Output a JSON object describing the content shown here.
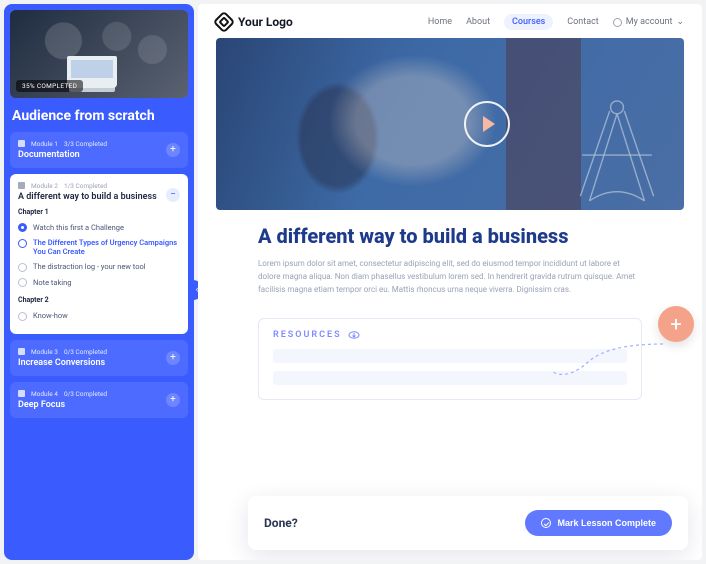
{
  "sidebar": {
    "progress_label": "35% COMPLETED",
    "course_title": "Audience from scratch",
    "modules": [
      {
        "index_label": "Module 1",
        "completed_label": "3/3 Completed",
        "name": "Documentation"
      },
      {
        "index_label": "Module 2",
        "completed_label": "1/3 Completed",
        "name": "A different way to build a business",
        "chapters": [
          {
            "label": "Chapter 1",
            "lessons": [
              {
                "status": "done",
                "title": "Watch this first a Challenge"
              },
              {
                "status": "active",
                "title": "The Different Types of Urgency Campaigns You Can Create"
              },
              {
                "status": "todo",
                "title": "The distraction log - your new tool"
              },
              {
                "status": "todo",
                "title": "Note taking"
              }
            ]
          },
          {
            "label": "Chapter 2",
            "lessons": [
              {
                "status": "todo",
                "title": "Know-how"
              }
            ]
          }
        ]
      },
      {
        "index_label": "Module 3",
        "completed_label": "0/3 Completed",
        "name": "Increase Conversions"
      },
      {
        "index_label": "Module 4",
        "completed_label": "0/3 Completed",
        "name": "Deep Focus"
      }
    ]
  },
  "header": {
    "logo_text": "Your Logo",
    "nav": {
      "home": "Home",
      "about": "About",
      "courses": "Courses",
      "contact": "Contact",
      "account": "My account"
    }
  },
  "lesson": {
    "title": "A different way to build a business",
    "body": "Lorem ipsum dolor sit amet, consectetur adipiscing elit, sed do eiusmod tempor incididunt ut labore et dolore magna aliqua. Non diam phasellus vestibulum lorem sed. In hendrerit gravida rutrum quisque. Amet facilisis magna etiam tempor orci eu. Mattis rhoncus urna neque viverra. Dignissim cras."
  },
  "resources": {
    "heading": "RESOURCES"
  },
  "done": {
    "question": "Done?",
    "button": "Mark Lesson Complete"
  }
}
